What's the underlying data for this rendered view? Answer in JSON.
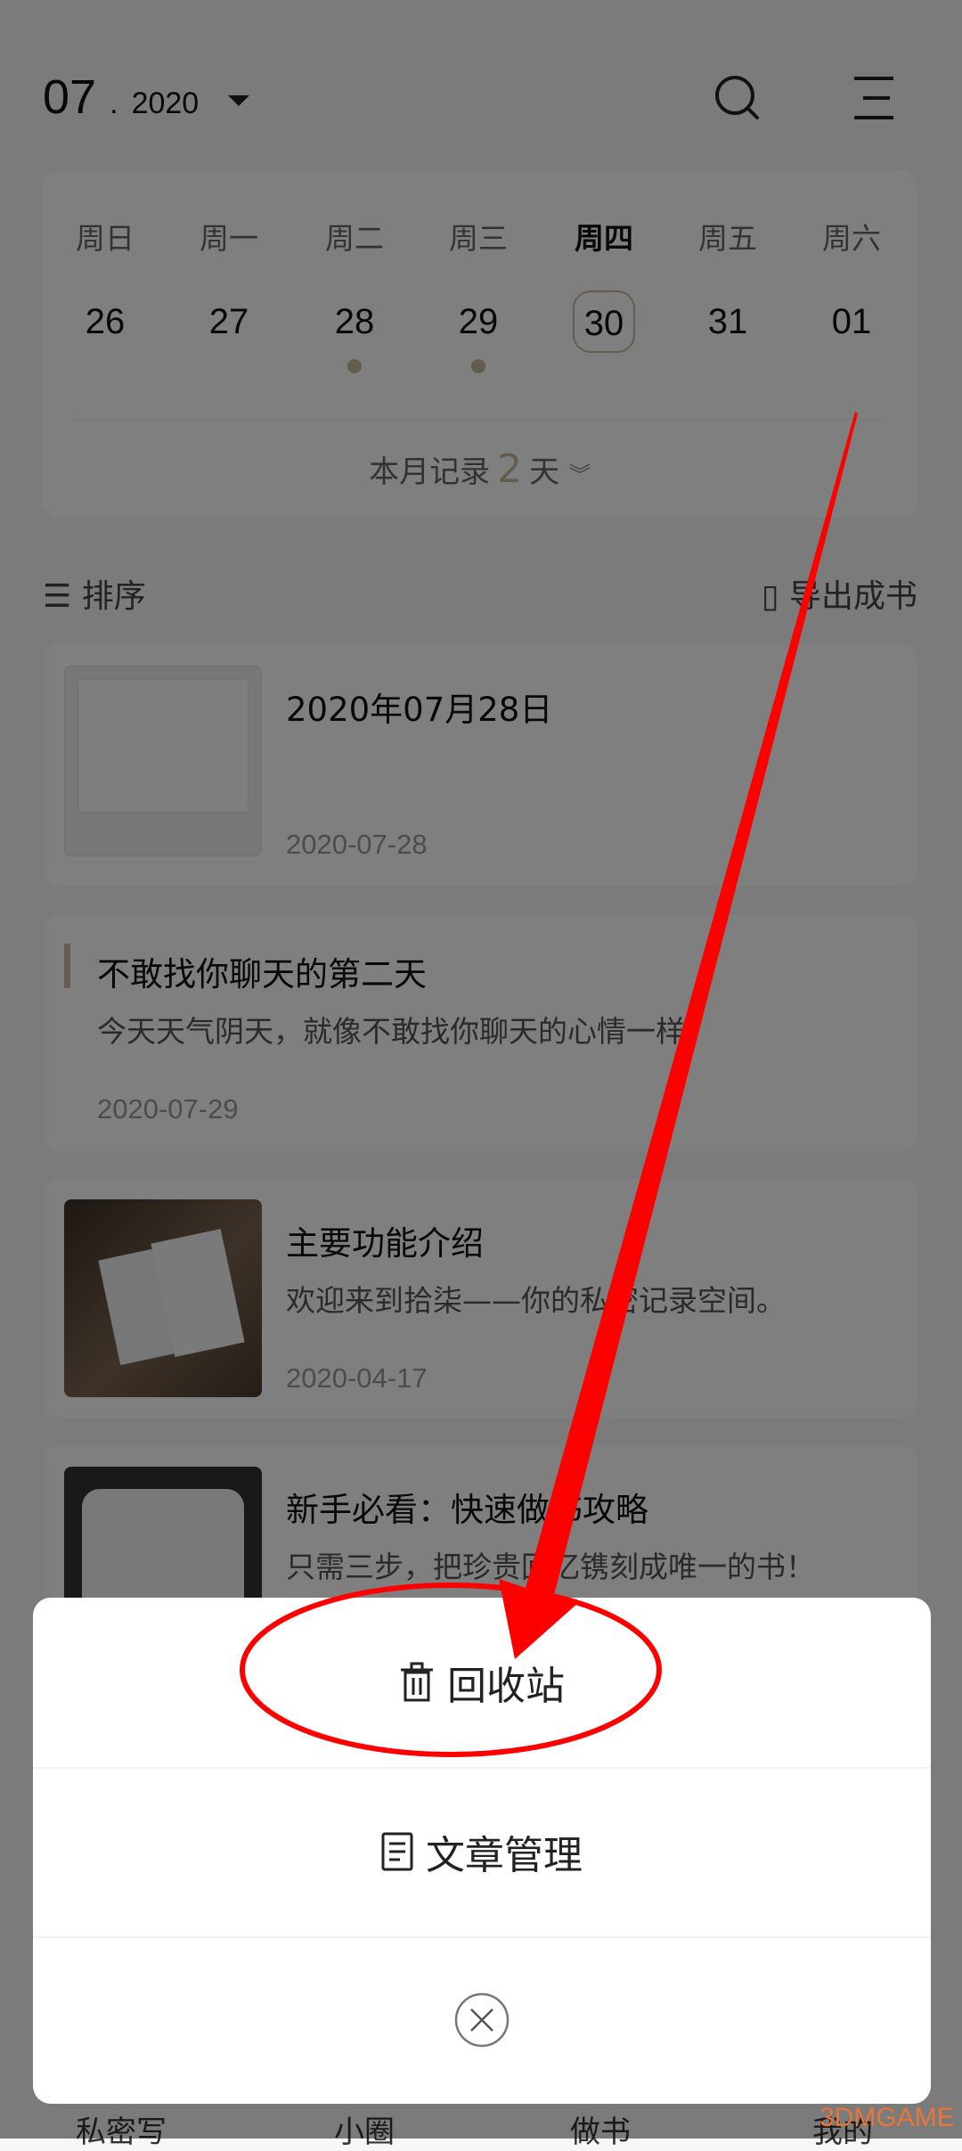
{
  "header": {
    "month": "07",
    "dot": ".",
    "year": "2020",
    "icons": [
      "search-icon",
      "menu-icon"
    ]
  },
  "calendar": {
    "weekdays": [
      "周日",
      "周一",
      "周二",
      "周三",
      "周四",
      "周五",
      "周六"
    ],
    "dates": [
      "26",
      "27",
      "28",
      "29",
      "30",
      "31",
      "01"
    ],
    "today_index": 4,
    "dates_with_records": [
      "28",
      "29"
    ],
    "summary_prefix": "本月记录",
    "summary_count": "2",
    "summary_suffix": "天"
  },
  "toolbar": {
    "sort_label": "排序",
    "export_label": "导出成书"
  },
  "entries": [
    {
      "title": "2020年07月28日",
      "date": "2020-07-28"
    },
    {
      "title": "不敢找你聊天的第二天",
      "body": "今天天气阴天，就像不敢找你聊天的心情一样",
      "date": "2020-07-29"
    },
    {
      "title": "主要功能介绍",
      "body": "欢迎来到拾柒——你的私密记录空间。",
      "date": "2020-04-17"
    },
    {
      "title": "新手必看：快速做书攻略",
      "body": "只需三步，把珍贵回忆镌刻成唯一的书！"
    }
  ],
  "bottom_nav": [
    "私密写",
    "小圈",
    "做书",
    "我的"
  ],
  "sheet": {
    "recycle_label": "回收站",
    "manage_label": "文章管理",
    "close_icon": "close-circle-icon"
  },
  "colors": {
    "accent": "#c9b89b",
    "annotation": "#ff0000"
  },
  "watermark": "3DMGAME"
}
